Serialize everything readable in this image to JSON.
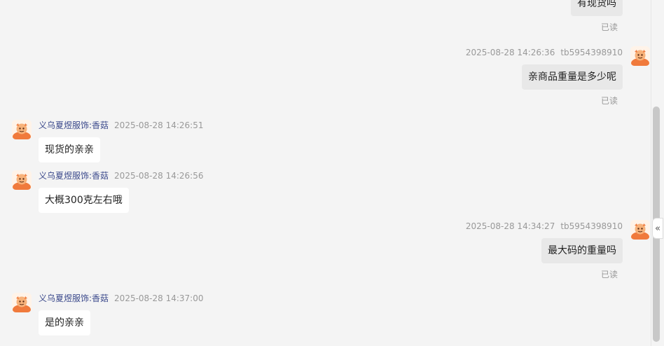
{
  "messages": {
    "m0": {
      "text": "有现货吗",
      "status": "已读"
    },
    "m1": {
      "time": "2025-08-28 14:26:36",
      "user": "tb5954398910",
      "text": "亲商品重量是多少呢",
      "status": "已读"
    },
    "m2": {
      "name": "义乌夏煜服饰:香菇",
      "time": "2025-08-28 14:26:51",
      "text": "现货的亲亲"
    },
    "m3": {
      "name": "义乌夏煜服饰:香菇",
      "time": "2025-08-28 14:26:56",
      "text": "大概300克左右哦"
    },
    "m4": {
      "time": "2025-08-28 14:34:27",
      "user": "tb5954398910",
      "text": "最大码的重量吗",
      "status": "已读"
    },
    "m5": {
      "name": "义乌夏煜服饰:香菇",
      "time": "2025-08-28 14:37:00",
      "text": "是的亲亲"
    }
  },
  "collapse_icon": "«",
  "colors": {
    "seller_name": "#3c4a8c",
    "outgoing_bubble": "#e8e8e8",
    "incoming_bubble": "#ffffff",
    "avatar_body": "#f07a3c"
  }
}
